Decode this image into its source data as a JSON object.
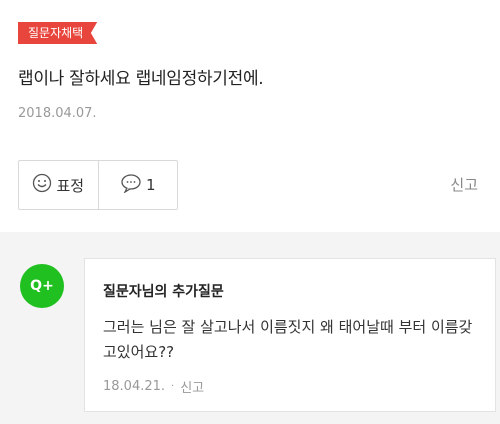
{
  "badge": {
    "label": "질문자채택"
  },
  "answer": {
    "text": "랩이나 잘하세요 랩네임정하기전에.",
    "date": "2018.04.07."
  },
  "actions": {
    "expression_label": "표정",
    "comment_count": "1",
    "report_label": "신고"
  },
  "followup": {
    "icon_label": "Q+",
    "title": "질문자님의 추가질문",
    "body": "그러는 님은 잘 살고나서 이름짓지 왜 태어날때 부터 이름갖고있어요??",
    "date": "18.04.21.",
    "separator": "·",
    "report_label": "신고"
  },
  "colors": {
    "badge": "#e8453c",
    "qplus": "#20c020",
    "followup_bg": "#f4f4f4"
  }
}
